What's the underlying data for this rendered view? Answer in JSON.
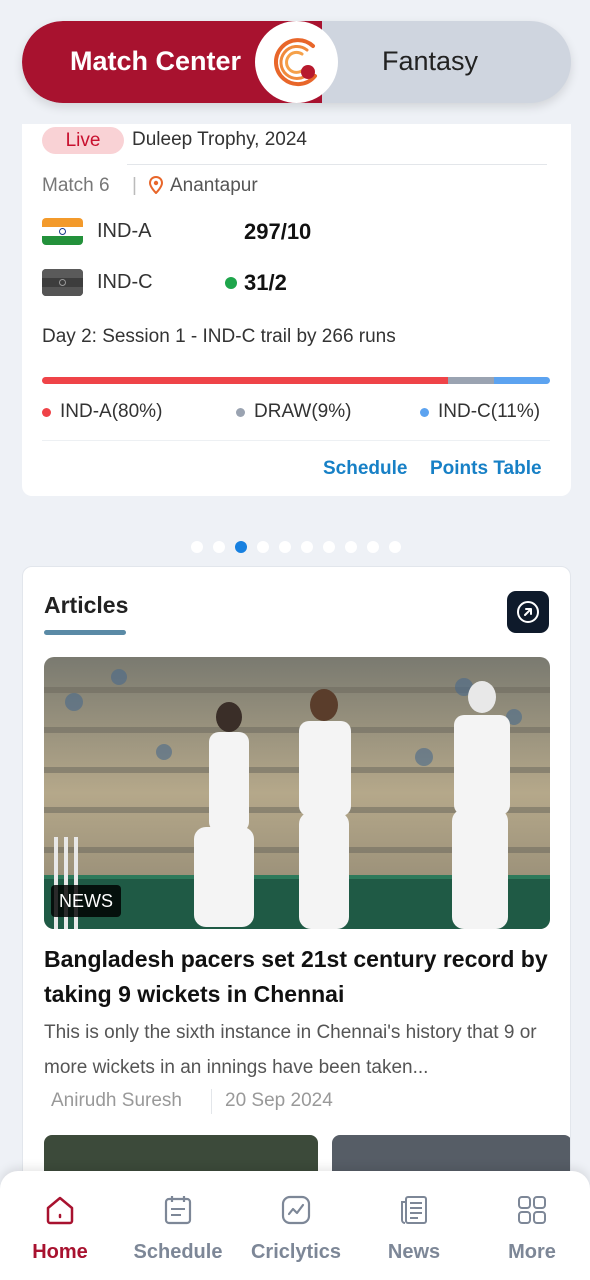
{
  "toggle": {
    "active": "Match Center",
    "inactive": "Fantasy"
  },
  "match": {
    "live_label": "Live",
    "series": "Duleep Trophy, 2024",
    "match_no": "Match 6",
    "separator": "|",
    "venue": "Anantapur",
    "teams": [
      {
        "name": "IND-A",
        "score": "297/10",
        "batting": false
      },
      {
        "name": "IND-C",
        "score": "31/2",
        "batting": true
      }
    ],
    "status": "Day 2: Session 1 - IND-C trail by 266 runs",
    "probability": [
      {
        "label": "IND-A(80%)",
        "value": 80,
        "color": "#ef4348"
      },
      {
        "label": "DRAW(9%)",
        "value": 9,
        "color": "#9aa3b1"
      },
      {
        "label": "IND-C(11%)",
        "value": 11,
        "color": "#5ca3f0"
      }
    ],
    "links": {
      "schedule": "Schedule",
      "points_table": "Points Table"
    }
  },
  "pager": {
    "total": 10,
    "active": 3
  },
  "articles": {
    "title": "Articles",
    "featured": {
      "tag": "NEWS",
      "headline": "Bangladesh pacers set 21st century record by taking 9 wickets in Chennai",
      "summary": "This is only the sixth instance in Chennai's history that 9 or more wickets in an innings have been taken...",
      "author": "Anirudh Suresh",
      "date": "20 Sep 2024"
    }
  },
  "nav": [
    {
      "label": "Home",
      "icon": "home-icon",
      "active": true
    },
    {
      "label": "Schedule",
      "icon": "calendar-icon",
      "active": false
    },
    {
      "label": "Criclytics",
      "icon": "analytics-icon",
      "active": false
    },
    {
      "label": "News",
      "icon": "newspaper-icon",
      "active": false
    },
    {
      "label": "More",
      "icon": "grid-icon",
      "active": false
    }
  ],
  "colors": {
    "brand": "#a8122f",
    "link": "#1780c6",
    "bg": "#eef1f6"
  }
}
